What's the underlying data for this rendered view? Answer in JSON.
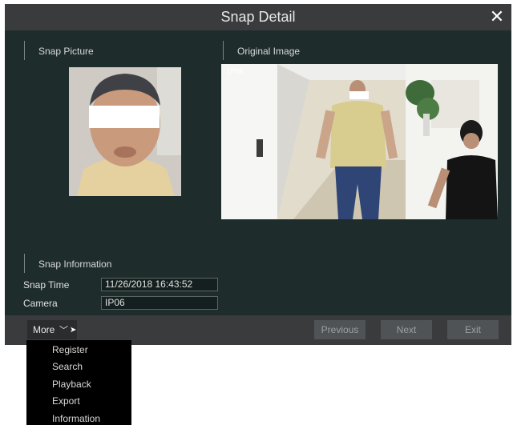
{
  "window": {
    "title": "Snap Detail"
  },
  "sections": {
    "snap_picture": "Snap Picture",
    "original_image": "Original Image",
    "snap_information": "Snap Information"
  },
  "snap_info": {
    "snap_time_label": "Snap Time",
    "snap_time_value": "11/26/2018 16:43:52",
    "camera_label": "Camera",
    "camera_value": "IP06"
  },
  "original_image": {
    "overlay_channel": "IP06"
  },
  "footer": {
    "more_label": "More",
    "previous_label": "Previous",
    "next_label": "Next",
    "exit_label": "Exit"
  },
  "more_menu": [
    "Register",
    "Search",
    "Playback",
    "Export",
    "Information"
  ]
}
